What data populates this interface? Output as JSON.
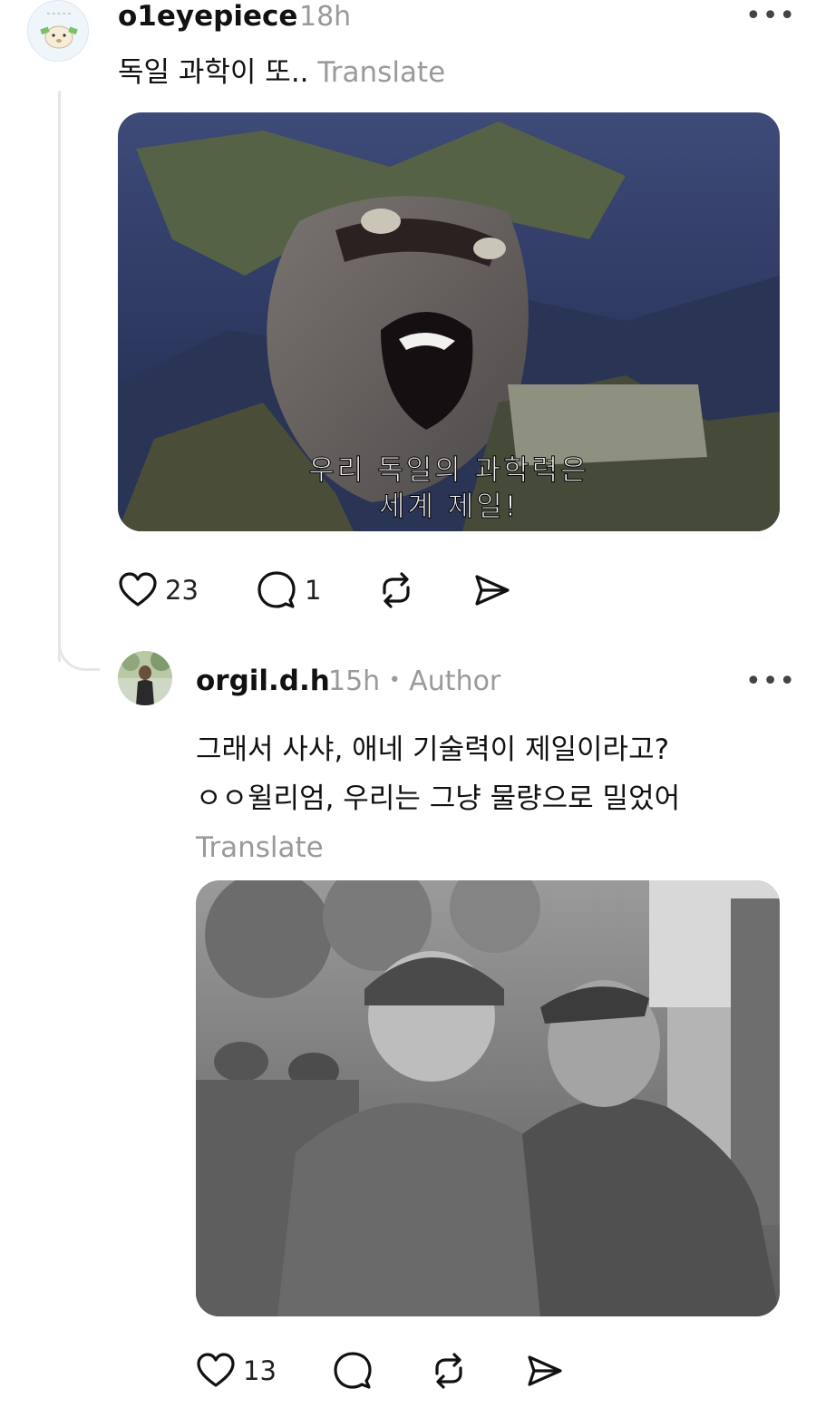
{
  "post": {
    "username": "o1eyepiece",
    "time": "18h",
    "more_label": "•••",
    "text": "독일 과학이 또..",
    "translate_label": "Translate",
    "image_subtitle_line1": "우리 독일의 과학력은",
    "image_subtitle_line2": "세계 제일!",
    "actions": {
      "like_count": "23",
      "reply_count": "1"
    }
  },
  "reply": {
    "username": "orgil.d.h",
    "time": "15h",
    "separator": "•",
    "author_badge": "Author",
    "more_label": "•••",
    "text_line1": "그래서 사샤, 애네 기술력이 제일이라고?",
    "text_line2": "ㅇㅇ윌리엄, 우리는 그냥 물량으로 밀었어",
    "translate_label": "Translate",
    "actions": {
      "like_count": "13"
    }
  },
  "icons": {
    "like": "heart-icon",
    "reply": "comment-bubble-icon",
    "repost": "repost-icon",
    "share": "send-icon",
    "more": "more-dots-icon"
  },
  "colors": {
    "text_primary": "#101010",
    "text_secondary": "#9a9a9a",
    "thread_line": "#e6e6e6"
  }
}
